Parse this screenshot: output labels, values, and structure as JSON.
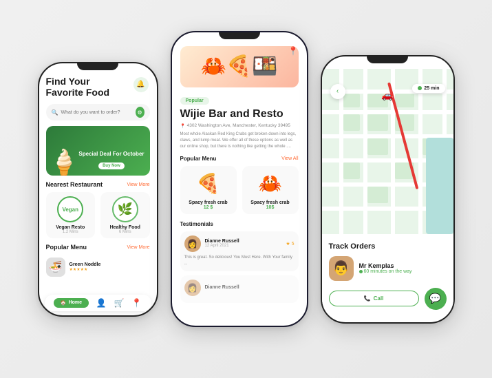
{
  "phone1": {
    "title": "Find Your\nFavorite Food",
    "search_placeholder": "What do you want to order?",
    "bell_icon": "🔔",
    "banner": {
      "label": "Special Deal For October",
      "button": "Buy Now",
      "emoji": "🍦"
    },
    "nearest_restaurant": {
      "title": "Nearest Restaurant",
      "view_more": "View More",
      "items": [
        {
          "name": "Vegan Resto",
          "distance": "1.2 Mins",
          "type": "vegan"
        },
        {
          "name": "Healthy Food",
          "distance": "6 Mins",
          "type": "healthy"
        }
      ]
    },
    "popular_menu": {
      "title": "Popular Menu",
      "view_more": "View More",
      "items": [
        {
          "name": "Green Noddle",
          "emoji": "🍜"
        }
      ]
    },
    "navbar": {
      "home": "Home",
      "icons": [
        "🏠",
        "👤",
        "🛒",
        "📍"
      ]
    }
  },
  "phone2": {
    "popular_badge": "Popular",
    "restaurant_name": "Wijie Bar and Resto",
    "address": "4302 Washington Ave, Manchester, Kentucky 39495",
    "description": "Most whole Alaskan Red King Crabs get broken down into legs, claws, and lump meat. We offer all of these options as well as our online shop, but there is nothing like getting the whole ....",
    "popular_menu": {
      "title": "Popular Menu",
      "view_all": "View All",
      "items": [
        {
          "name": "Spacy fresh crab",
          "price": "12 $",
          "emoji": "🍕"
        },
        {
          "name": "Spacy fresh crab",
          "price": "10$",
          "emoji": "🦀"
        }
      ]
    },
    "testimonials": {
      "title": "Testimonials",
      "items": [
        {
          "name": "Dianne Russell",
          "date": "12 April 2021",
          "stars": 5,
          "text": "This is great. So delicious! You Must Here. With Your family ...",
          "emoji": "👩"
        },
        {
          "name": "Dianne Russell",
          "text": "",
          "emoji": "👩"
        }
      ]
    }
  },
  "phone3": {
    "back_icon": "‹",
    "time": "25 min",
    "track_title": "Track Orders",
    "driver": {
      "name": "Mr Kemplas",
      "status": "60 minutes on the way",
      "emoji": "👨"
    },
    "call_label": "Call",
    "chat_icon": "💬"
  }
}
